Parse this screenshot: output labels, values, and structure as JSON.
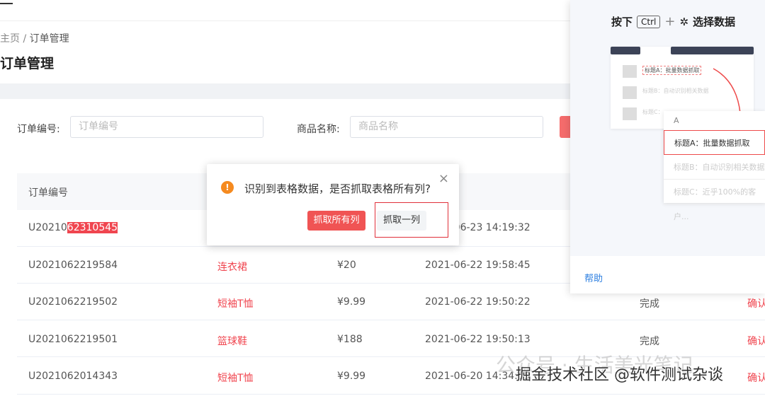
{
  "breadcrumb": {
    "home": "主页",
    "sep": "/",
    "current": "订单管理"
  },
  "page_title": "订单管理",
  "filters": [
    {
      "label": "订单编号:",
      "placeholder": "订单编号"
    },
    {
      "label": "商品名称:",
      "placeholder": "商品名称"
    }
  ],
  "table": {
    "header_order": "订单编号",
    "rows": [
      {
        "order_prefix": "U20210",
        "order_highlight": "62310545",
        "product": "",
        "price": "",
        "time": "2021-06-23 14:19:32",
        "status": "",
        "action": ""
      },
      {
        "order": "U2021062219584",
        "product": "连衣裙",
        "price": "¥20",
        "time": "2021-06-22 19:58:45",
        "status": "",
        "action": ""
      },
      {
        "order": "U2021062219502",
        "product": "短袖T恤",
        "price": "¥9.99",
        "time": "2021-06-22 19:50:22",
        "status": "完成",
        "action": "确认"
      },
      {
        "order": "U2021062219501",
        "product": "篮球鞋",
        "price": "¥188",
        "time": "2021-06-22 19:50:13",
        "status": "完成",
        "action": "确认"
      },
      {
        "order": "U2021062014343",
        "product": "短袖T恤",
        "price": "¥9.99",
        "time": "2021-06-20 14:34:39",
        "status": "",
        "action": "确认"
      }
    ]
  },
  "dialog": {
    "message": "识别到表格数据，是否抓取表格所有列?",
    "close": "×",
    "btn_all": "抓取所有列",
    "btn_one": "抓取一列"
  },
  "panel": {
    "title_press": "按下",
    "key": "Ctrl",
    "plus": "+",
    "title_select": "选择数据",
    "mock_items": [
      "标题A：批量数据抓取",
      "标题B：自动识别相关数据",
      "标题C："
    ],
    "col_header": "A",
    "zoom_items": [
      "标题A：批量数据抓取",
      "标题B：自动识别相关数据",
      "标题C：近乎100%的客户..."
    ],
    "help": "帮助"
  },
  "watermarks": [
    "公众号 · 生活美光笔记",
    "掘金技术社区 @软件测试杂谈"
  ]
}
